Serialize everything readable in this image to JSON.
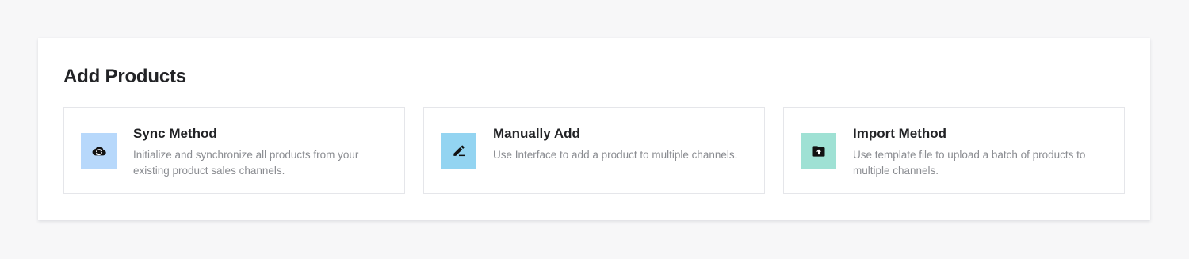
{
  "panel": {
    "title": "Add Products"
  },
  "cards": [
    {
      "title": "Sync Method",
      "description": "Initialize and synchronize all products from your existing product sales channels.",
      "icon": "cloud-sync-icon",
      "icon_bg": "#b7d8fb"
    },
    {
      "title": "Manually Add",
      "description": "Use Interface to add a product to multiple channels.",
      "icon": "edit-pen-icon",
      "icon_bg": "#93d4f1"
    },
    {
      "title": "Import Method",
      "description": "Use template file to upload a batch of products to multiple channels.",
      "icon": "folder-upload-icon",
      "icon_bg": "#9fe1d4"
    }
  ]
}
